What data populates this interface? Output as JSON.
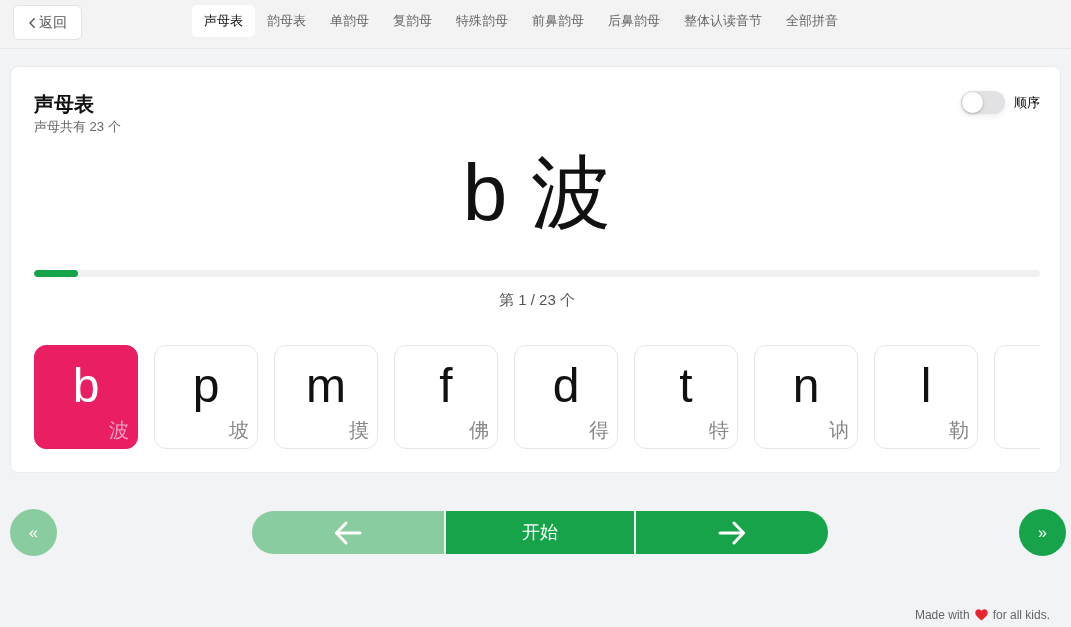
{
  "back_button": {
    "label": "返回"
  },
  "tabs": [
    {
      "label": "声母表",
      "selected": true
    },
    {
      "label": "韵母表",
      "selected": false
    },
    {
      "label": "单韵母",
      "selected": false
    },
    {
      "label": "复韵母",
      "selected": false
    },
    {
      "label": "特殊韵母",
      "selected": false
    },
    {
      "label": "前鼻韵母",
      "selected": false
    },
    {
      "label": "后鼻韵母",
      "selected": false
    },
    {
      "label": "整体认读音节",
      "selected": false
    },
    {
      "label": "全部拼音",
      "selected": false
    }
  ],
  "panel": {
    "title": "声母表",
    "subtitle": "声母共有 23 个",
    "order_toggle": {
      "label": "顺序",
      "on": false
    },
    "current": {
      "letter": "b",
      "hanzi": "波"
    },
    "progress": {
      "level": 0.0435,
      "reading": "第 1 / 23 个"
    },
    "cards": [
      {
        "letter": "b",
        "hanzi": "波",
        "selected": true
      },
      {
        "letter": "p",
        "hanzi": "坡",
        "selected": false
      },
      {
        "letter": "m",
        "hanzi": "摸",
        "selected": false
      },
      {
        "letter": "f",
        "hanzi": "佛",
        "selected": false
      },
      {
        "letter": "d",
        "hanzi": "得",
        "selected": false
      },
      {
        "letter": "t",
        "hanzi": "特",
        "selected": false
      },
      {
        "letter": "n",
        "hanzi": "讷",
        "selected": false
      },
      {
        "letter": "l",
        "hanzi": "勒",
        "selected": false
      },
      {
        "selected": false
      }
    ]
  },
  "controls": {
    "first_button": {
      "label": "«",
      "disabled": true
    },
    "prev_button": {
      "disabled": true
    },
    "start_button": {
      "label": "开始"
    },
    "next_button": {
      "disabled": false
    },
    "last_button": {
      "label": "»",
      "disabled": false
    }
  },
  "footer": {
    "before": "Made with",
    "after": "for all kids."
  }
}
